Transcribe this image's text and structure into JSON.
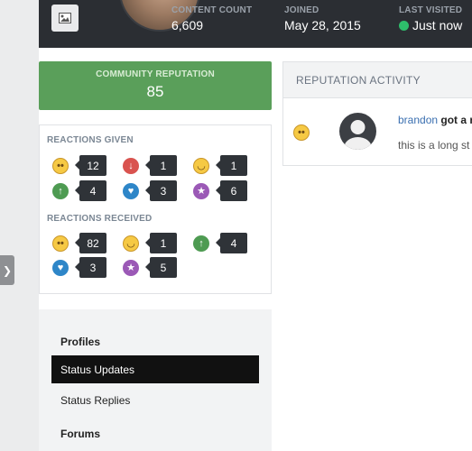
{
  "header": {
    "stats": [
      {
        "label": "CONTENT COUNT",
        "value": "6,609"
      },
      {
        "label": "JOINED",
        "value": "May 28, 2015"
      },
      {
        "label": "LAST VISITED",
        "value": "Just now"
      }
    ],
    "online_color": "#2ebd6b"
  },
  "reputation": {
    "label": "COMMUNITY REPUTATION",
    "value": "85",
    "color": "#5a9f5a"
  },
  "reactions": {
    "given_title": "REACTIONS GIVEN",
    "given": [
      {
        "icon": "confused-icon",
        "count": "12"
      },
      {
        "icon": "thumbs-down-icon",
        "count": "1"
      },
      {
        "icon": "haha-icon",
        "count": "1"
      },
      {
        "icon": "thumbs-up-icon",
        "count": "4"
      },
      {
        "icon": "heart-icon",
        "count": "3"
      },
      {
        "icon": "trophy-icon",
        "count": "6"
      }
    ],
    "received_title": "REACTIONS RECEIVED",
    "received": [
      {
        "icon": "confused-icon",
        "count": "82"
      },
      {
        "icon": "haha-icon",
        "count": "1"
      },
      {
        "icon": "thumbs-up-icon",
        "count": "4"
      },
      {
        "icon": "heart-icon",
        "count": "3"
      },
      {
        "icon": "trophy-icon",
        "count": "5"
      }
    ]
  },
  "nav": {
    "profiles_heading": "Profiles",
    "status_updates": "Status Updates",
    "status_replies": "Status Replies",
    "forums_heading": "Forums"
  },
  "activity": {
    "title": "REPUTATION ACTIVITY",
    "item": {
      "user": "brandon",
      "title_fragment": "got a r",
      "snippet": "this is a long st"
    }
  }
}
